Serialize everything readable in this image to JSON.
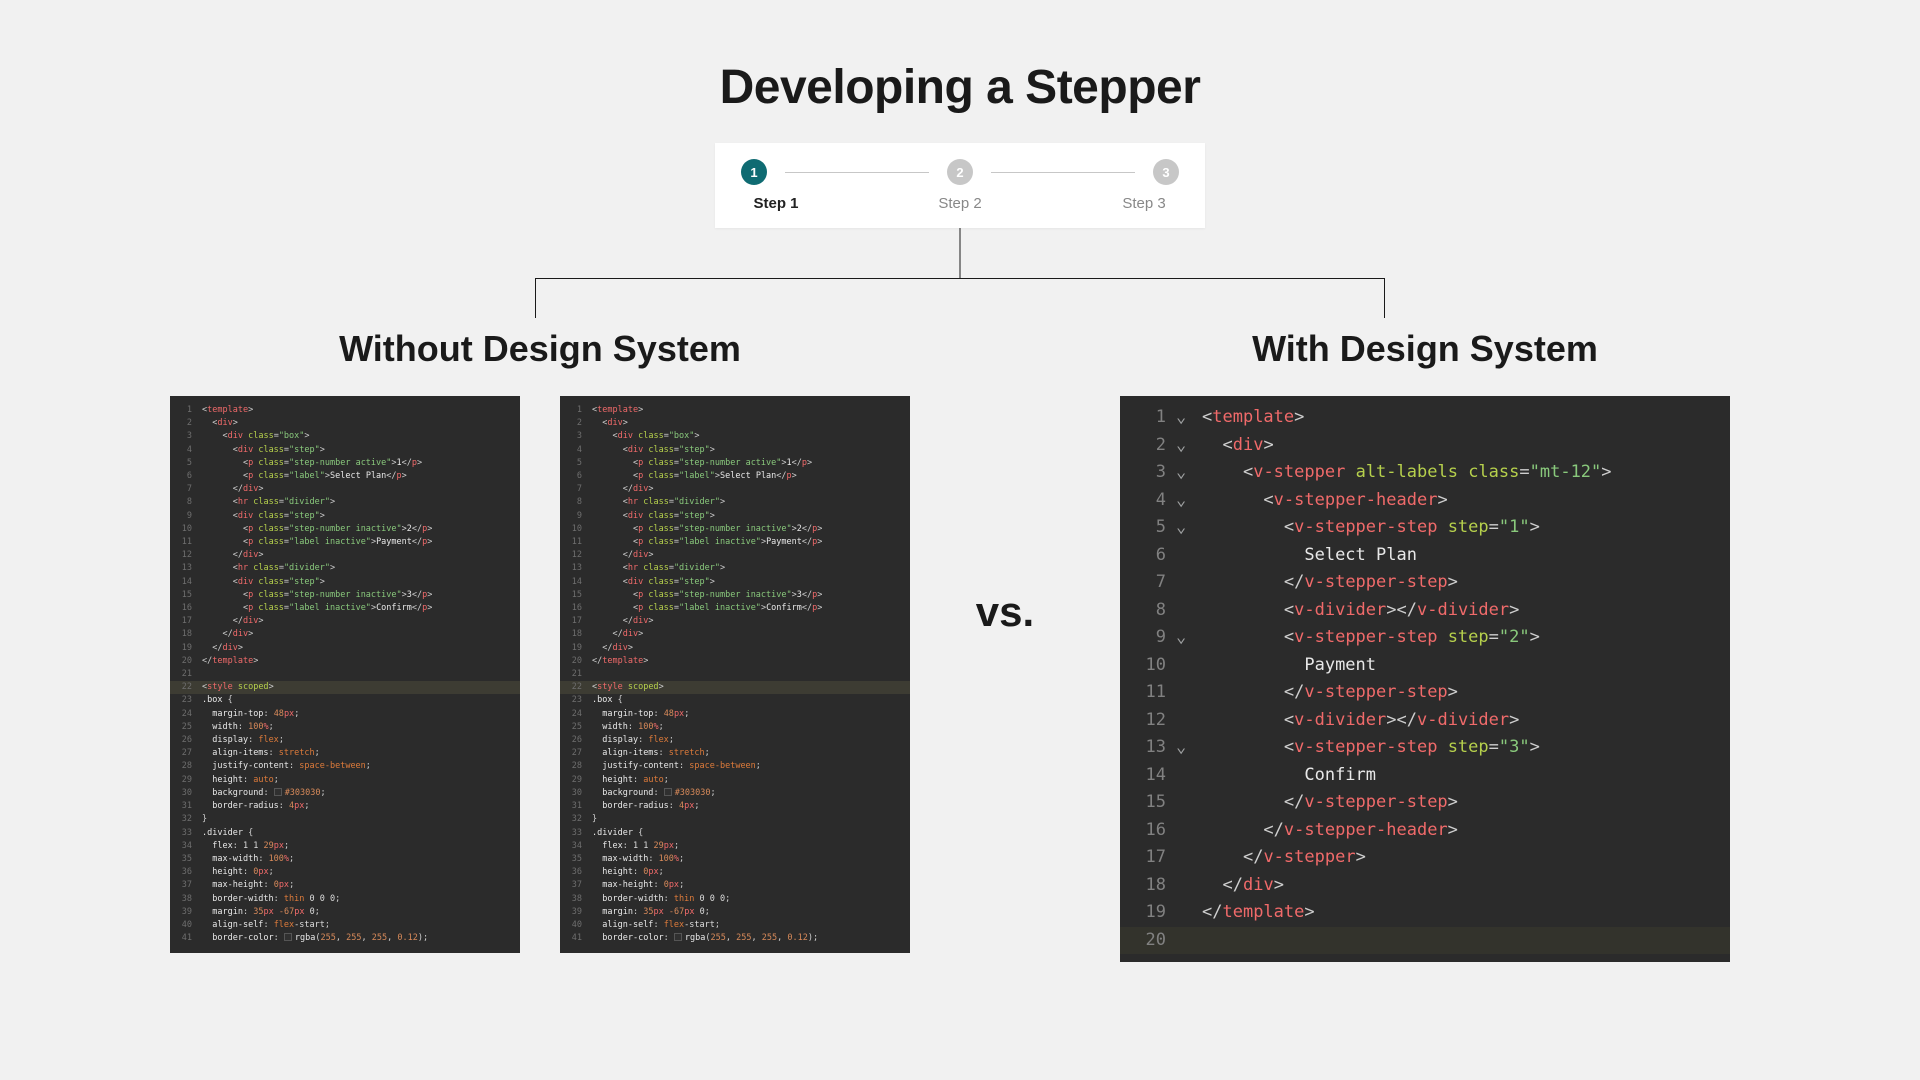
{
  "title": "Developing a Stepper",
  "stepper": {
    "steps": [
      {
        "num": "1",
        "label": "Step 1",
        "active": true
      },
      {
        "num": "2",
        "label": "Step 2",
        "active": false
      },
      {
        "num": "3",
        "label": "Step 3",
        "active": false
      }
    ]
  },
  "headings": {
    "left": "Without Design System",
    "right": "With Design System",
    "vs": "vs."
  },
  "code": {
    "leftA": [
      "<template>",
      "  <div>",
      "    <div class=\"box\">",
      "      <div class=\"step\">",
      "        <p class=\"step-number active\">1</p>",
      "        <p class=\"label\">Select Plan</p>",
      "      </div>",
      "      <hr class=\"divider\">",
      "      <div class=\"step\">",
      "        <p class=\"step-number inactive\">2</p>",
      "        <p class=\"label inactive\">Payment</p>",
      "      </div>",
      "      <hr class=\"divider\">",
      "      <div class=\"step\">",
      "        <p class=\"step-number inactive\">3</p>",
      "        <p class=\"label inactive\">Confirm</p>",
      "      </div>",
      "    </div>",
      "  </div>",
      "</template>",
      "",
      "<style scoped>",
      ".box {",
      "  margin-top: 48px;",
      "  width: 100%;",
      "  display: flex;",
      "  align-items: stretch;",
      "  justify-content: space-between;",
      "  height: auto;",
      "  background: #303030;",
      "  border-radius: 4px;",
      "}",
      ".divider {",
      "  flex: 1 1 29px;",
      "  max-width: 100%;",
      "  height: 0px;",
      "  max-height: 0px;",
      "  border-width: thin 0 0 0;",
      "  margin: 35px -67px 0;",
      "  align-self: flex-start;",
      "  border-color: rgba(255, 255, 255, 0.12);"
    ],
    "leftB": [
      "<template>",
      "  <div>",
      "    <div class=\"box\">",
      "      <div class=\"step\">",
      "        <p class=\"step-number active\">1</p>",
      "        <p class=\"label\">Select Plan</p>",
      "      </div>",
      "      <hr class=\"divider\">",
      "      <div class=\"step\">",
      "        <p class=\"step-number inactive\">2</p>",
      "        <p class=\"label inactive\">Payment</p>",
      "      </div>",
      "      <hr class=\"divider\">",
      "      <div class=\"step\">",
      "        <p class=\"step-number inactive\">3</p>",
      "        <p class=\"label inactive\">Confirm</p>",
      "      </div>",
      "    </div>",
      "  </div>",
      "</template>",
      "",
      "<style scoped>",
      ".box {",
      "  margin-top: 48px;",
      "  width: 100%;",
      "  display: flex;",
      "  align-items: stretch;",
      "  justify-content: space-between;",
      "  height: auto;",
      "  background: #303030;",
      "  border-radius: 4px;",
      "}",
      ".divider {",
      "  flex: 1 1 29px;",
      "  max-width: 100%;",
      "  height: 0px;",
      "  max-height: 0px;",
      "  border-width: thin 0 0 0;",
      "  margin: 35px -67px 0;",
      "  align-self: flex-start;",
      "  border-color: rgba(255, 255, 255, 0.12);"
    ],
    "right": [
      {
        "fold": "v",
        "text": "<template>"
      },
      {
        "fold": "v",
        "text": "  <div>"
      },
      {
        "fold": "v",
        "text": "    <v-stepper alt-labels class=\"mt-12\">"
      },
      {
        "fold": "v",
        "text": "      <v-stepper-header>"
      },
      {
        "fold": "v",
        "text": "        <v-stepper-step step=\"1\">"
      },
      {
        "fold": " ",
        "text": "          Select Plan"
      },
      {
        "fold": " ",
        "text": "        </v-stepper-step>"
      },
      {
        "fold": " ",
        "text": "        <v-divider></v-divider>"
      },
      {
        "fold": "v",
        "text": "        <v-stepper-step step=\"2\">"
      },
      {
        "fold": " ",
        "text": "          Payment"
      },
      {
        "fold": " ",
        "text": "        </v-stepper-step>"
      },
      {
        "fold": " ",
        "text": "        <v-divider></v-divider>"
      },
      {
        "fold": "v",
        "text": "        <v-stepper-step step=\"3\">"
      },
      {
        "fold": " ",
        "text": "          Confirm"
      },
      {
        "fold": " ",
        "text": "        </v-stepper-step>"
      },
      {
        "fold": " ",
        "text": "      </v-stepper-header>"
      },
      {
        "fold": " ",
        "text": "    </v-stepper>"
      },
      {
        "fold": " ",
        "text": "  </div>"
      },
      {
        "fold": " ",
        "text": "</template>"
      },
      {
        "fold": " ",
        "text": ""
      }
    ],
    "smallHighlight": 22,
    "bigHighlight": 20
  }
}
